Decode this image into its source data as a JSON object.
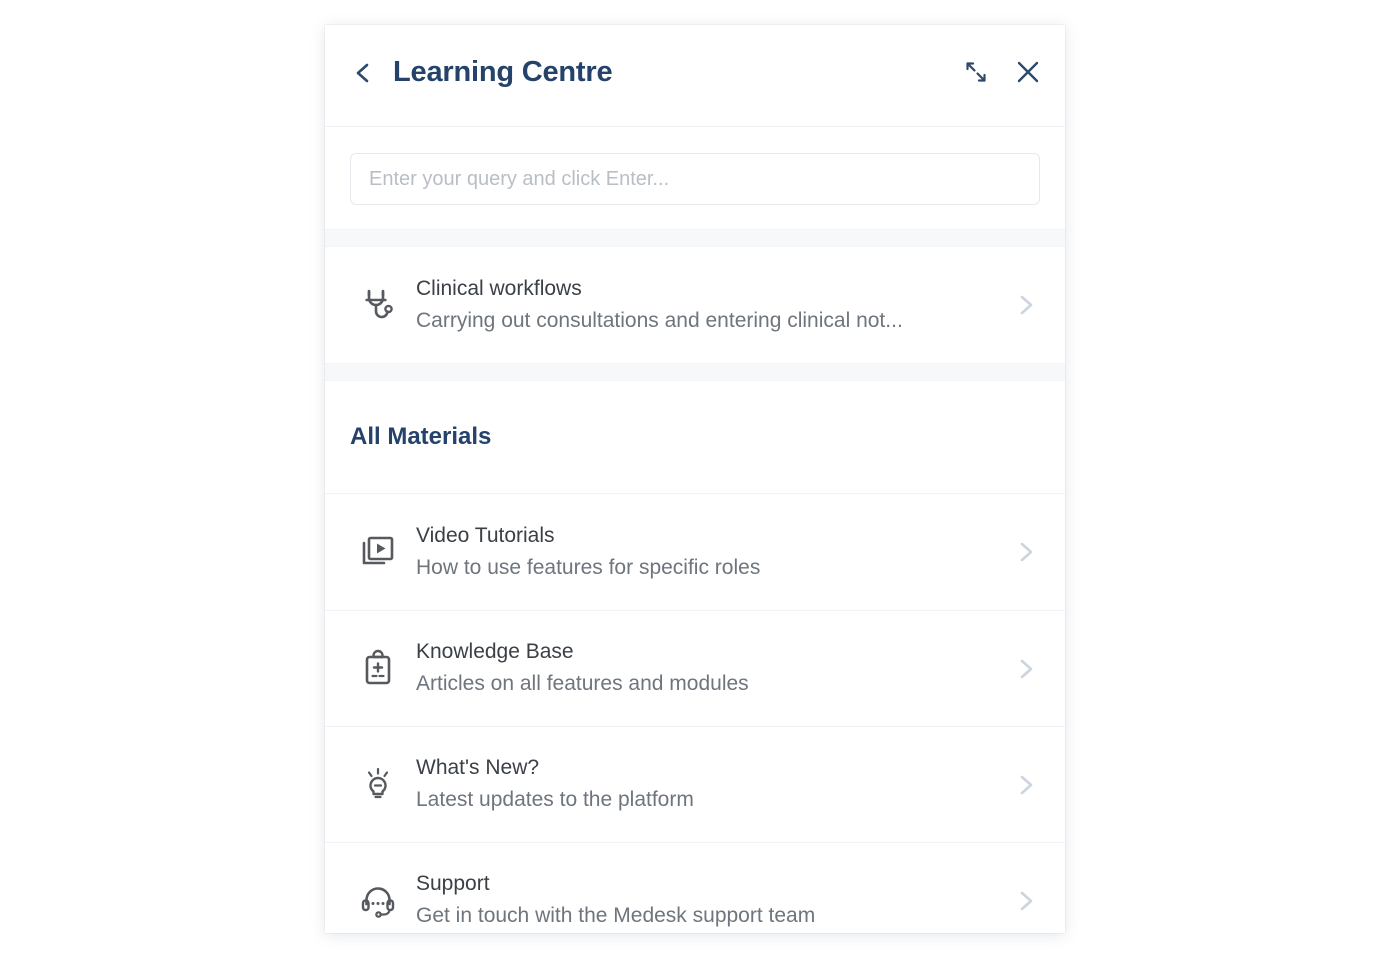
{
  "panel": {
    "title": "Learning Centre",
    "back_icon": "chevron-left-icon",
    "expand_icon": "expand-diagonal-icon",
    "close_icon": "close-icon"
  },
  "search": {
    "placeholder": "Enter your query and click Enter...",
    "value": ""
  },
  "featured": [
    {
      "icon": "stethoscope-icon",
      "title": "Clinical workflows",
      "subtitle": "Carrying out consultations and entering clinical not...",
      "chevron": "chevron-right-icon"
    }
  ],
  "section": {
    "heading": "All Materials"
  },
  "materials": [
    {
      "icon": "video-tutorials-icon",
      "title": "Video Tutorials",
      "subtitle": "How to use features for specific roles",
      "chevron": "chevron-right-icon"
    },
    {
      "icon": "clipboard-medical-icon",
      "title": "Knowledge Base",
      "subtitle": "Articles on all features and modules",
      "chevron": "chevron-right-icon"
    },
    {
      "icon": "lightbulb-icon",
      "title": "What's New?",
      "subtitle": "Latest updates to the platform",
      "chevron": "chevron-right-icon"
    },
    {
      "icon": "headset-support-icon",
      "title": "Support",
      "subtitle": "Get in touch with the Medesk support team",
      "chevron": "chevron-right-icon"
    }
  ],
  "colors": {
    "brand_navy": "#24426a",
    "row_title": "#3b4046",
    "row_subtitle": "#6e757d",
    "chevron": "#ccd4de",
    "band": "#f7f8fa",
    "panel_bg": "#ffffff"
  }
}
